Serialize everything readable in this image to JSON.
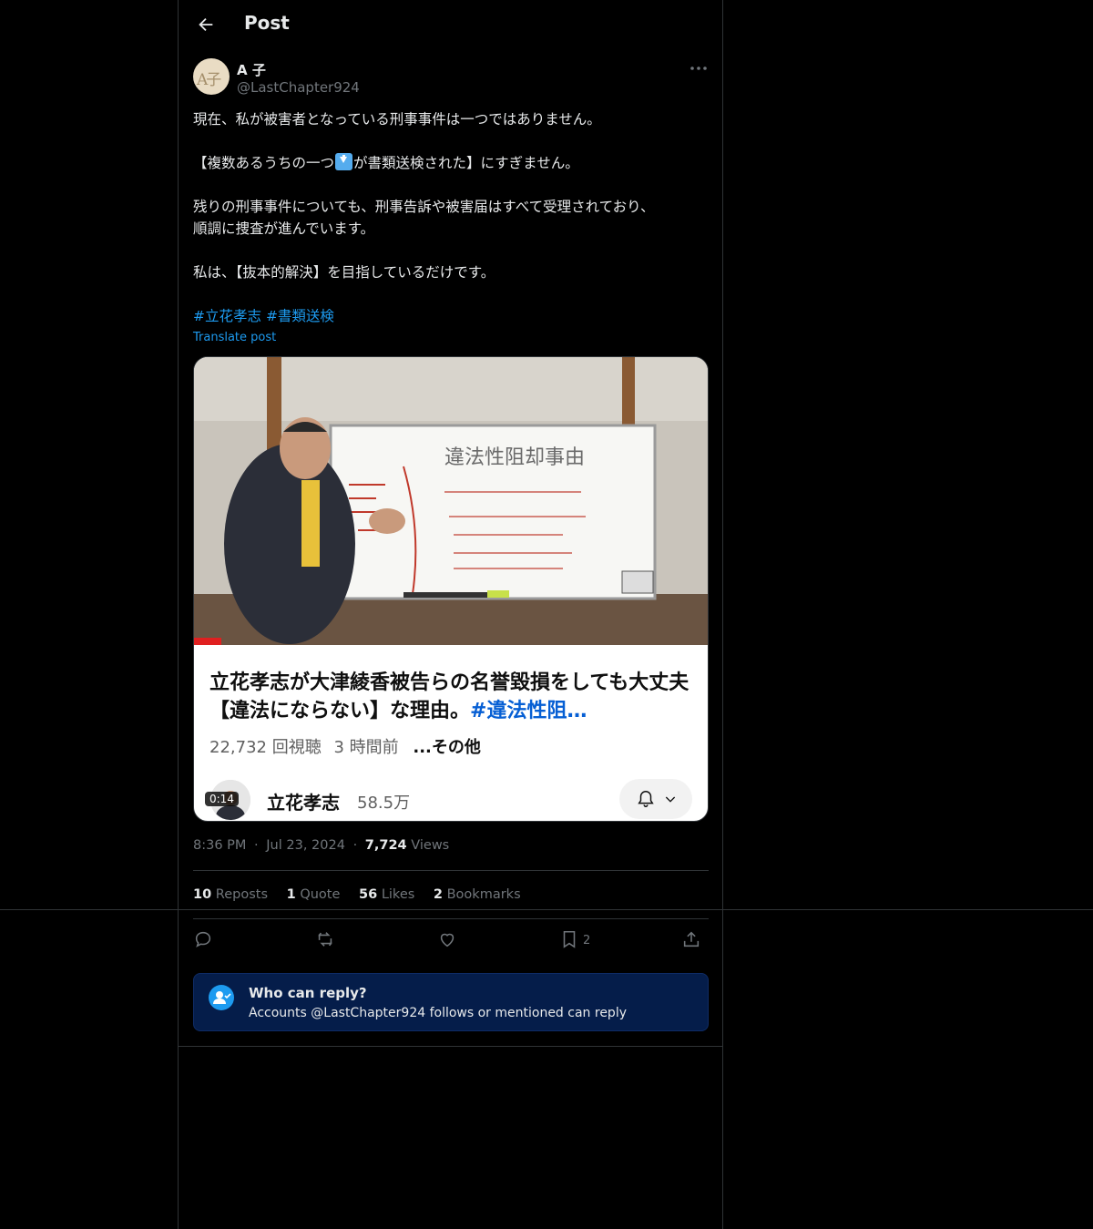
{
  "header": {
    "title": "Post"
  },
  "author": {
    "display_name": "A 子",
    "handle": "@LastChapter924",
    "avatar_text": "A子"
  },
  "post": {
    "line1": "現在、私が被害者となっている刑事事件は一つではありません。",
    "line2_a": "【複数あるうちの一つ",
    "line2_emoji": "down-arrow-emoji",
    "line2_b": "が書類送検された】にすぎません。",
    "line3": "残りの刑事事件についても、刑事告訴や被害届はすべて受理されており、",
    "line4": "順調に捜査が進んでいます。",
    "line5": "私は、【抜本的解決】を目指しているだけです。",
    "hashtags": [
      "#立花孝志",
      "#書類送検"
    ],
    "translate": "Translate post"
  },
  "video_card": {
    "title": "立花孝志が大津綾香被告らの名誉毀損をしても大丈夫【違法にならない】な理由。",
    "title_tag": "#違法性阻…",
    "views": "22,732 回視聴",
    "time_ago": "3 時間前",
    "more": "...その他",
    "channel_name": "立花孝志",
    "channel_subs": "58.5万",
    "duration": "0:14",
    "whiteboard_title": "違法性阻却事由"
  },
  "meta": {
    "time": "8:36 PM",
    "date": "Jul 23, 2024",
    "views_count": "7,724",
    "views_label": "Views",
    "sep": "·"
  },
  "stats": {
    "reposts_count": "10",
    "reposts_label": "Reposts",
    "quotes_count": "1",
    "quotes_label": "Quote",
    "likes_count": "56",
    "likes_label": "Likes",
    "bookmarks_count": "2",
    "bookmarks_label": "Bookmarks"
  },
  "actions": {
    "bookmark_count": "2"
  },
  "reply_settings": {
    "title": "Who can reply?",
    "subtitle": "Accounts @LastChapter924 follows or mentioned can reply"
  },
  "colors": {
    "accent": "#1d9bf0",
    "background": "#000000",
    "text": "#e7e9ea",
    "muted": "#71767b"
  }
}
